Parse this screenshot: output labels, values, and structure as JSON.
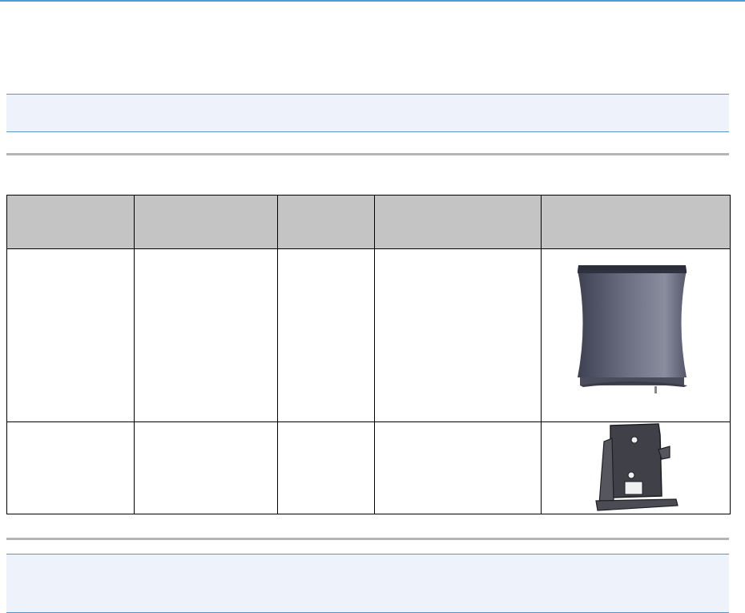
{
  "header": {
    "title": "",
    "subtitle": ""
  },
  "note_top": {
    "text": ""
  },
  "table": {
    "columns": [
      "",
      "",
      "",
      "",
      ""
    ],
    "rows": [
      {
        "cells": [
          "",
          "",
          "",
          ""
        ],
        "image_icon": "air-purifier-unit-icon"
      },
      {
        "cells": [
          "",
          "",
          "",
          ""
        ],
        "image_icon": "mounting-bracket-icon"
      }
    ]
  },
  "note_bottom": {
    "text": ""
  },
  "colors": {
    "accent_rule": "#4a9fd6",
    "note_background": "#eef3fb",
    "table_header": "#c4c4c4",
    "section_rule": "#b5b5b5"
  }
}
